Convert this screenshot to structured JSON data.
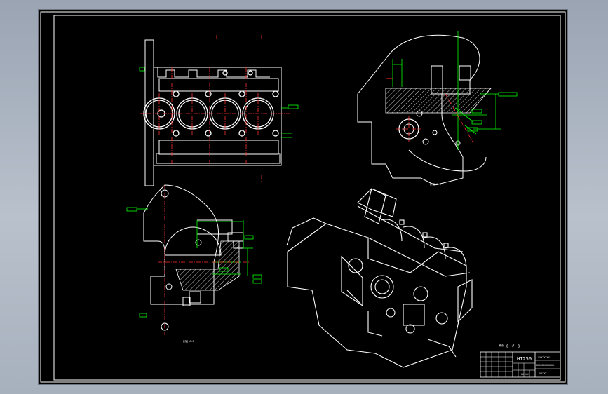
{
  "drawing": {
    "section_aa_label": "剖面 A-A",
    "section_bb_label": "剖面 B-B",
    "roughness_note": "其余",
    "roughness_value": "( √ )"
  },
  "title_block": {
    "material": "HT250",
    "drawing_number": "XXXXXXXX",
    "part_name": "XXXXXXXXXXXX",
    "company": "XXXXX",
    "sheet_info": "XX XX"
  },
  "colors": {
    "geometry": "#ffffff",
    "center_line": "#ff3030",
    "dimension": "#00ff00",
    "background": "#000000"
  }
}
